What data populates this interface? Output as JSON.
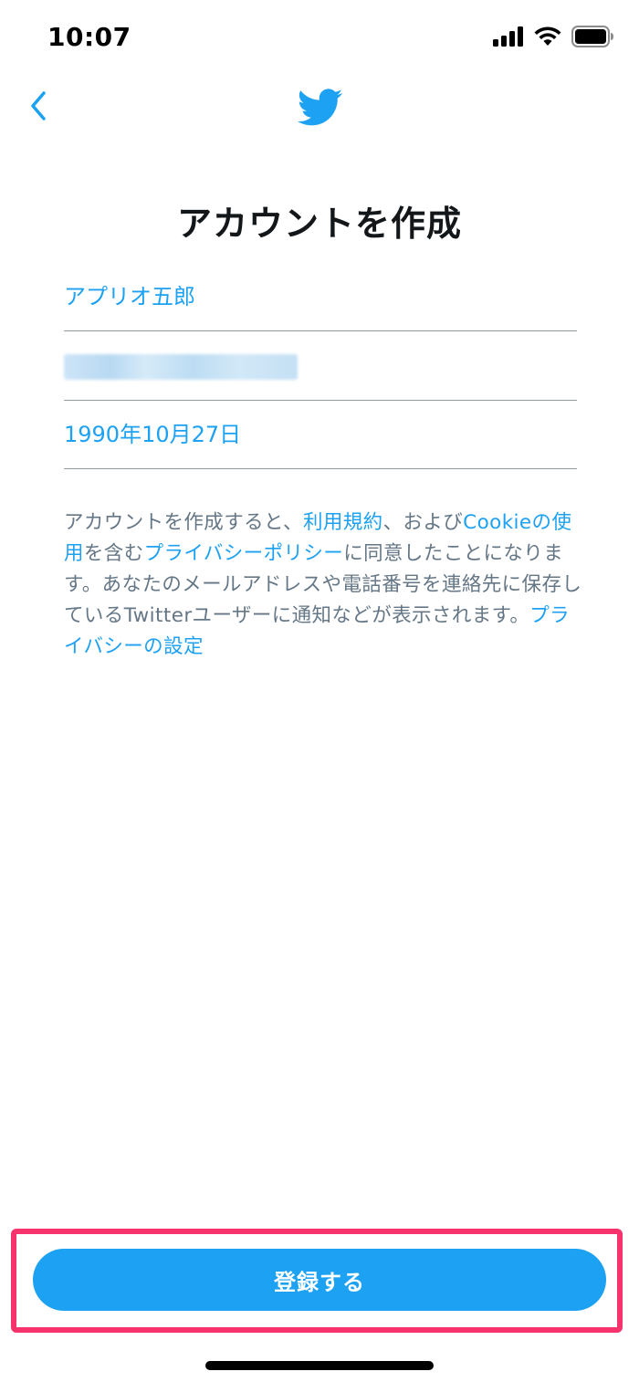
{
  "status_bar": {
    "time": "10:07",
    "icons": [
      "cellular-signal-icon",
      "wifi-icon",
      "battery-icon"
    ]
  },
  "nav": {
    "back_icon": "chevron-left-icon",
    "logo_icon": "twitter-bird-icon"
  },
  "title": "アカウントを作成",
  "form": {
    "name_value": "アプリオ五郎",
    "contact_value": "",
    "birthday_value": "1990年10月27日"
  },
  "terms": {
    "part1": "アカウントを作成すると、",
    "link_terms": "利用規約",
    "part2": "、および",
    "link_cookie": "Cookieの使用",
    "part3": "を含む",
    "link_privacy_policy": "プライバシーポリシー",
    "part4": "に同意したことになります。あなたのメールアドレスや電話番号を連絡先に保存しているTwitterユーザーに通知などが表示されます。",
    "link_privacy_settings": "プライバシーの設定"
  },
  "register_button_label": "登録する",
  "colors": {
    "accent": "#1da1f2",
    "highlight": "#f7336e",
    "muted_text": "#657786",
    "divider": "#8f9aa3"
  }
}
